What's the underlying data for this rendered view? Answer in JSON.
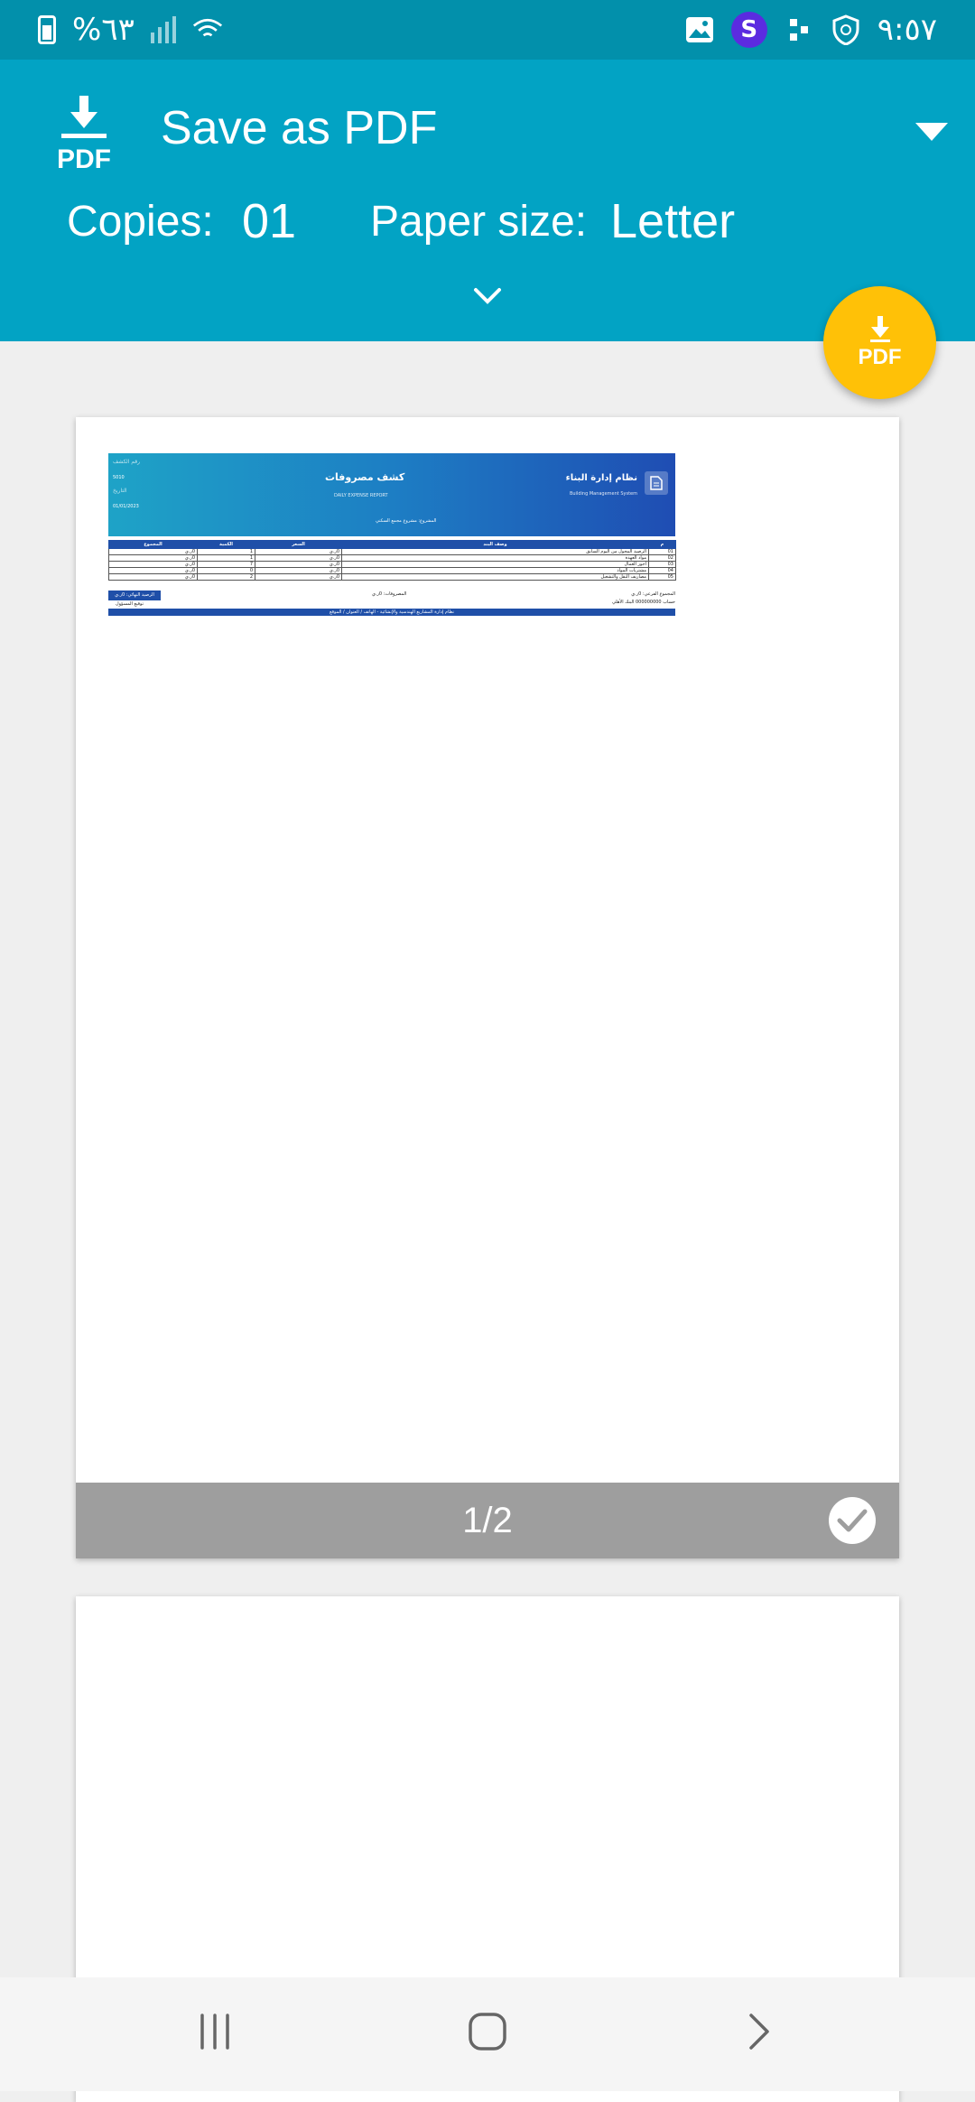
{
  "status_bar": {
    "battery": "%٦٣",
    "time": "٩:٥٧",
    "wifi_badge": "6",
    "app_badge": "S"
  },
  "header": {
    "pdf_logo_text": "PDF",
    "title": "Save as PDF",
    "copies_label": "Copies:",
    "copies_value": "01",
    "paper_label": "Paper size:",
    "paper_value": "Letter"
  },
  "fab": {
    "label": "PDF"
  },
  "preview": {
    "page_indicator": "1/2",
    "document": {
      "system_name": "نظام إدارة البناء",
      "system_name_en": "Building Management System",
      "report_title": "كشف مصروفات",
      "report_subtitle": "DAILY EXPENSE REPORT",
      "project_line": "المشروع: مشروع مجمع السكني",
      "meta_no_label": "رقم الكشف",
      "meta_no_value": "5010",
      "meta_date_label": "التاريخ",
      "meta_date_value": "01/01/2023",
      "columns": [
        "م",
        "وصف البند",
        "السعر",
        "الكمية",
        "المجموع"
      ],
      "rows": [
        [
          "01",
          "الرصيد المحول من اليوم السابق",
          "0ر.ي",
          "1",
          "0ر.ي"
        ],
        [
          "02",
          "مواد العهدة",
          "0ر.ي",
          "1",
          "0ر.ي"
        ],
        [
          "03",
          "أجور العمال",
          "0ر.ي",
          "7",
          "0ر.ي"
        ],
        [
          "04",
          "مشتريات المواد",
          "0ر.ي",
          "0",
          "0ر.ي"
        ],
        [
          "05",
          "مصاريف النقل والتشغيل",
          "0ر.ي",
          "2",
          "0ر.ي"
        ]
      ],
      "sum_label": "المجموع الفرعي: 0ر.ي",
      "account_label": "حساب 000000000    البنك الأهلي",
      "expenses_label": "المصروفات: 0ر.ي",
      "total_label": "الرصيد النهائي: 0ر.ي",
      "signature_label": "توقيع المسؤول",
      "footer_text": "نظام إدارة المشاريع الهندسية والإنشائية - الهاتف / العنوان / الموقع"
    }
  }
}
